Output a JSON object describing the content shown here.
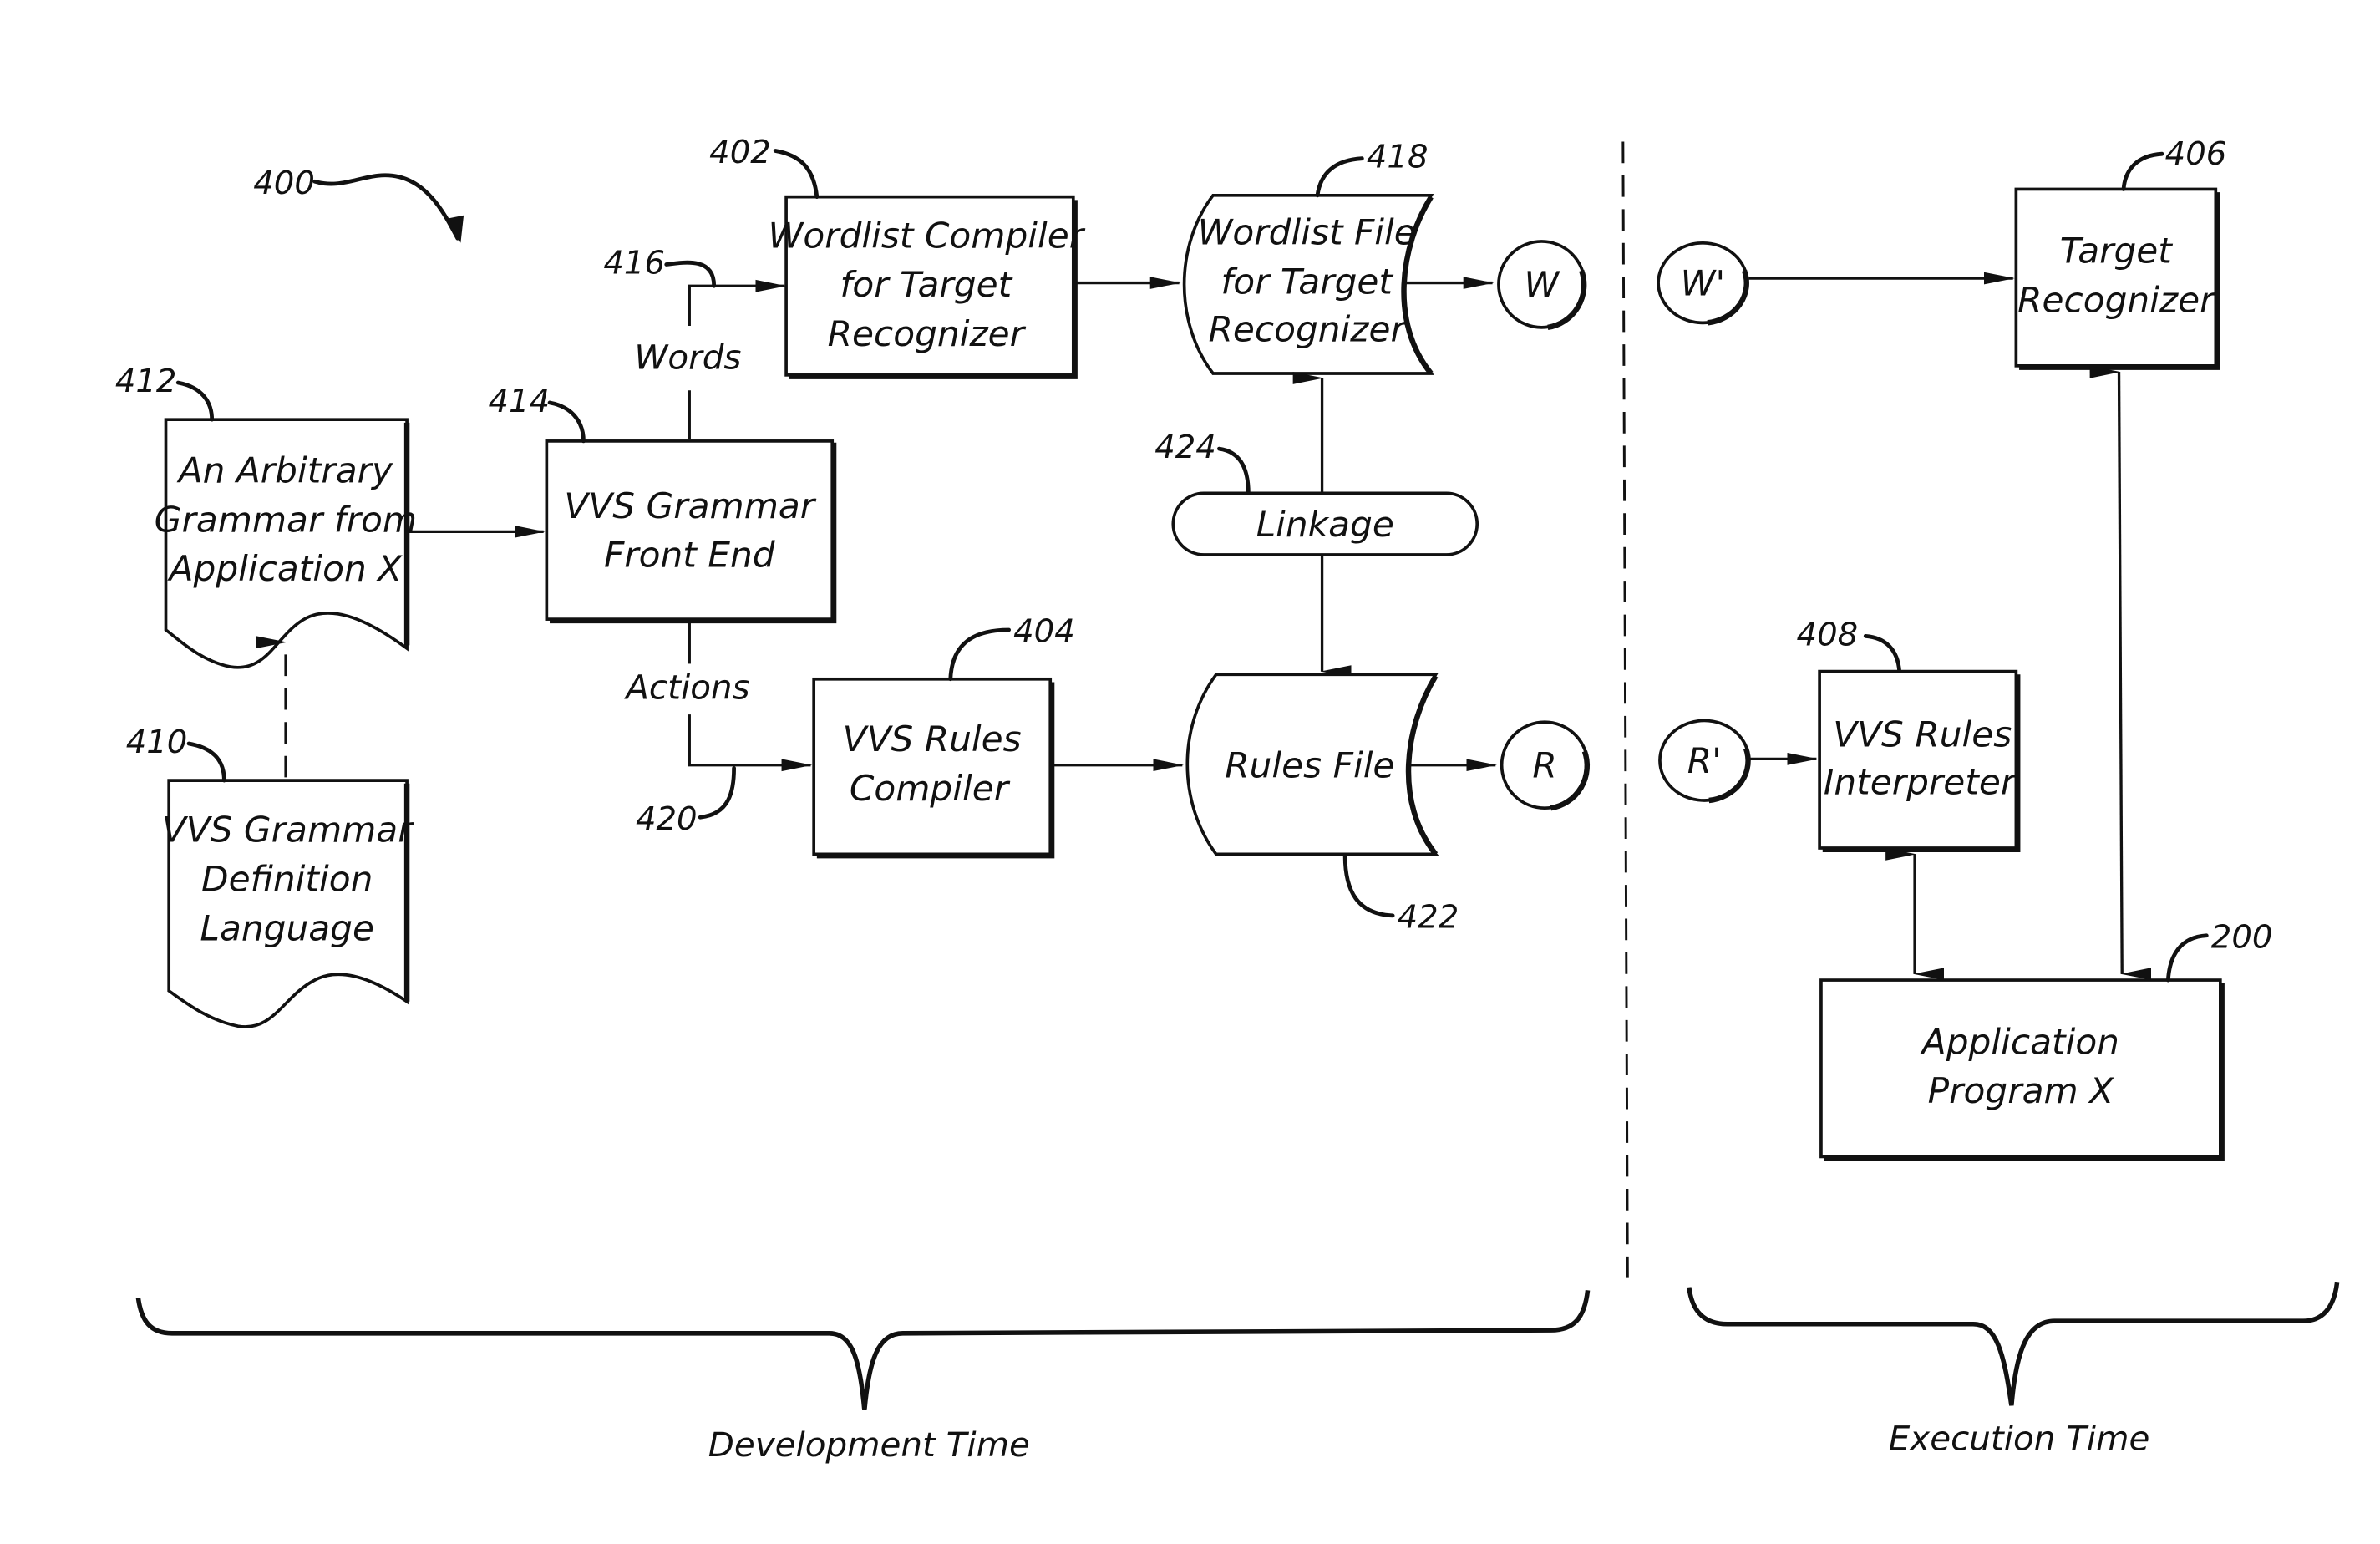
{
  "figure": {
    "ref": "400",
    "nodes": {
      "n412": {
        "ref": "412",
        "lines": [
          "An Arbitrary",
          "Grammar from",
          "Application X"
        ]
      },
      "n410": {
        "ref": "410",
        "lines": [
          "VVS Grammar",
          "Definition",
          "Language"
        ]
      },
      "n414": {
        "ref": "414",
        "lines": [
          "VVS Grammar",
          "Front End"
        ]
      },
      "n402": {
        "ref": "402",
        "lines": [
          "Wordlist Compiler",
          "for Target",
          "Recognizer"
        ]
      },
      "n418": {
        "ref": "418",
        "lines": [
          "Wordlist File",
          "for Target",
          "Recognizer"
        ]
      },
      "n424": {
        "ref": "424",
        "lines": [
          "Linkage"
        ]
      },
      "n404": {
        "ref": "404",
        "lines": [
          "VVS Rules",
          "Compiler"
        ]
      },
      "n422": {
        "ref": "422",
        "lines": [
          "Rules File"
        ]
      },
      "n406": {
        "ref": "406",
        "lines": [
          "Target",
          "Recognizer"
        ]
      },
      "n408": {
        "ref": "408",
        "lines": [
          "VVS Rules",
          "Interpreter"
        ]
      },
      "n200": {
        "ref": "200",
        "lines": [
          "Application",
          "Program X"
        ]
      }
    },
    "connectors": {
      "w": "W",
      "r": "R",
      "w_prime": "W'",
      "r_prime": "R'"
    },
    "edge_labels": {
      "words": "Words",
      "words_ref": "416",
      "actions": "Actions",
      "actions_ref": "420"
    },
    "phases": {
      "development": "Development Time",
      "execution": "Execution Time"
    }
  }
}
